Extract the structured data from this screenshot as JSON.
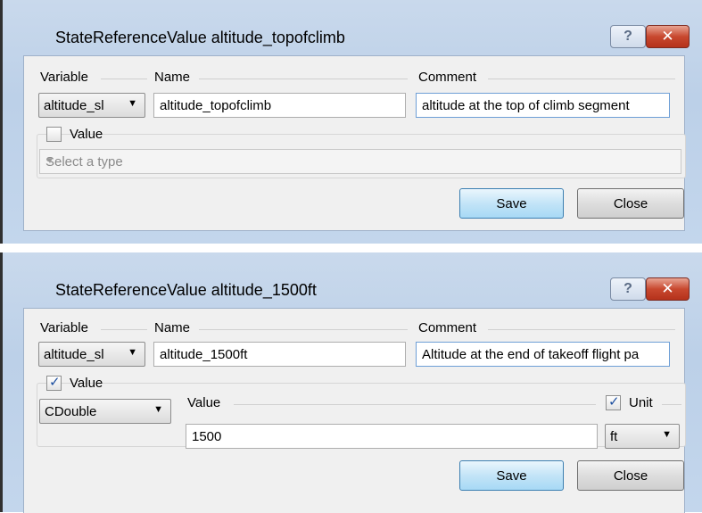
{
  "dialog1": {
    "title": "StateReferenceValue altitude_topofclimb",
    "help_icon": "?",
    "close_icon": "✕",
    "variable_label": "Variable",
    "variable_value": "altitude_sl",
    "name_label": "Name",
    "name_value": "altitude_topofclimb",
    "comment_label": "Comment",
    "comment_value": "altitude at the top of climb segment",
    "value_label": "Value",
    "value_checked": false,
    "type_placeholder": "Select a type",
    "save_label": "Save",
    "close_label": "Close"
  },
  "dialog2": {
    "title": "StateReferenceValue altitude_1500ft",
    "help_icon": "?",
    "close_icon": "✕",
    "variable_label": "Variable",
    "variable_value": "altitude_sl",
    "name_label": "Name",
    "name_value": "altitude_1500ft",
    "comment_label": "Comment",
    "comment_value": "Altitude at the end of takeoff flight pa",
    "value_label": "Value",
    "value_checked": true,
    "type_value": "CDouble",
    "inner_value_label": "Value",
    "inner_value": "1500",
    "unit_label": "Unit",
    "unit_checked": true,
    "unit_value": "ft",
    "save_label": "Save",
    "close_label": "Close"
  },
  "icons": {
    "dropdown": "▼",
    "check": "✓"
  }
}
